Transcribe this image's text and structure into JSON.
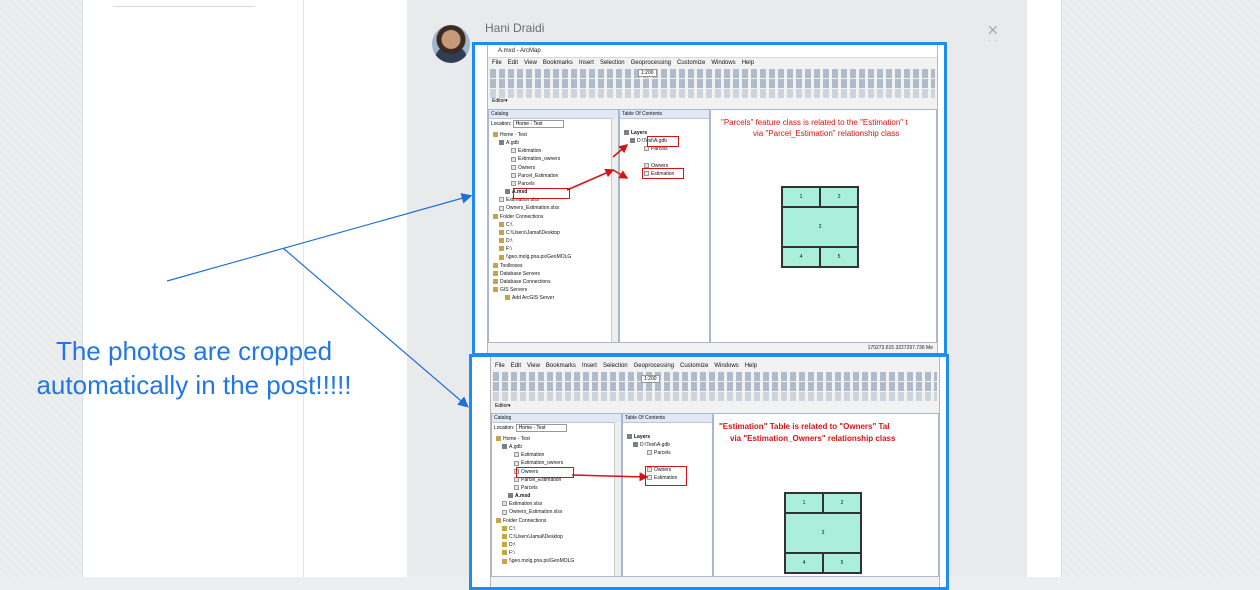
{
  "post": {
    "author": "Hani Draidi",
    "close_icon": "close-icon"
  },
  "annotation": {
    "line1": "The photos are cropped",
    "line2": "automatically in the post!!!!!",
    "color": "#2177e5"
  },
  "arcmap": {
    "window_title": "A.mxd - ArcMap",
    "menu": [
      "File",
      "Edit",
      "View",
      "Bookmarks",
      "Insert",
      "Selection",
      "Geoprocessing",
      "Customize",
      "Windows",
      "Help"
    ],
    "scale": "1:200",
    "editor_label": "Editor▾",
    "catalog_title": "Catalog",
    "location_label": "Location:",
    "location_value": "Home - Test",
    "toc_title": "Table Of Contents",
    "status_coords": "170273.615 3227297.736 Me",
    "tree_shot1": [
      "Home - Test",
      "A.gdb",
      "Estimation",
      "Estimation_owners",
      "Owners",
      "Parcel_Estimation",
      "Parcels",
      "A.mxd",
      "Estimation.xlsx",
      "Owners_Estimation.xlsx",
      "Folder Connections",
      "C:\\",
      "C:\\Users\\Jamal\\Desktop",
      "D:\\",
      "F:\\",
      "\\\\geo.molg.pna.ps\\GeoMOLG",
      "Toolboxes",
      "Database Servers",
      "Database Connections",
      "GIS Servers",
      "Add ArcGIS Server"
    ],
    "tree_shot2": [
      "Home - Test",
      "A.gdb",
      "Estimation",
      "Estimation_owners",
      "Owners",
      "Parcel_Estimation",
      "Parcels",
      "A.mxd",
      "Estimation.xlsx",
      "Owners_Estimation.xlsx",
      "Folder Connections",
      "C:\\",
      "C:\\Users\\Jamal\\Desktop",
      "D:\\",
      "F:\\",
      "\\\\geo.molg.pna.ps\\GeoMOLG"
    ],
    "toc_shot1": [
      "Layers",
      "D:\\Test\\A.gdb",
      "Parcels",
      "Owners",
      "Estimation"
    ],
    "toc_shot2": [
      "Layers",
      "D:\\Test\\A.gdb",
      "Parcels",
      "Owners",
      "Estimation"
    ],
    "note1_line1": "\"Parcels\" feature class is related to the \"Estimation\" t",
    "note1_line2": "via \"Parcel_Estimation\" relationship class",
    "note2_line1": "\"Estimation\" Table is related to \"Owners\" Tal",
    "note2_line2": "via \"Estimation_Owners\" relationship class",
    "parcel_ids": [
      "1",
      "2",
      "3",
      "4",
      "5"
    ]
  }
}
